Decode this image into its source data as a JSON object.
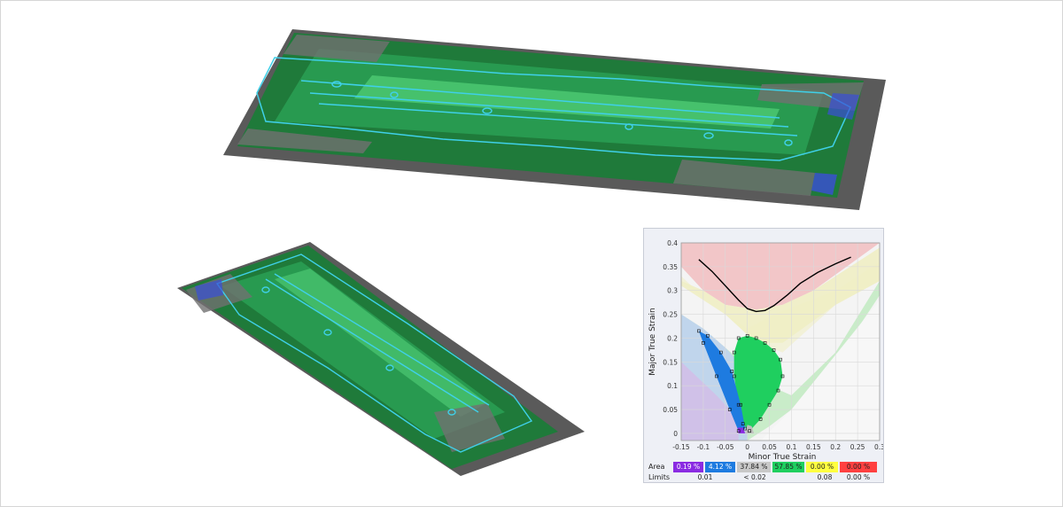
{
  "chart_data": {
    "type": "scatter",
    "title": "",
    "xlabel": "Minor True Strain",
    "ylabel": "Major True Strain",
    "xlim": [
      -0.15,
      0.3
    ],
    "ylim": [
      -0.015,
      0.4
    ],
    "xticks": [
      "-0.15",
      "-0.1",
      "-0.05",
      "0",
      "0.05",
      "0.1",
      "0.15",
      "0.2",
      "0.25",
      "0.3"
    ],
    "xtick_values": [
      -0.15,
      -0.1,
      -0.05,
      0,
      0.05,
      0.1,
      0.15,
      0.2,
      0.25,
      0.3
    ],
    "yticks": [
      "0",
      "0.05",
      "0.1",
      "0.15",
      "0.2",
      "0.25",
      "0.3",
      "0.35",
      "0.4"
    ],
    "ytick_values": [
      0,
      0.05,
      0.1,
      0.15,
      0.2,
      0.25,
      0.3,
      0.35,
      0.4
    ],
    "grid": true,
    "forming_limit_curve": {
      "x": [
        -0.11,
        -0.08,
        -0.05,
        -0.02,
        0.0,
        0.02,
        0.04,
        0.06,
        0.09,
        0.12,
        0.16,
        0.2,
        0.235
      ],
      "y": [
        0.365,
        0.34,
        0.31,
        0.28,
        0.262,
        0.256,
        0.258,
        0.268,
        0.29,
        0.315,
        0.338,
        0.356,
        0.37
      ]
    },
    "zone_colors": {
      "red": "#f2c6c8",
      "yellow": "#f0eec4",
      "green": "#c9ecc9",
      "blue": "#bfd3f0",
      "purple": "#d2bfe8",
      "grey": "#f4f4f4",
      "point_green": "#1fcf5f",
      "point_blue": "#1e7be0",
      "point_purple": "#8a2be2",
      "point_grey": "#bdbdbd"
    },
    "point_cloud": {
      "green_region": [
        [
          -0.02,
          0.2
        ],
        [
          0.0,
          0.205
        ],
        [
          0.02,
          0.2
        ],
        [
          0.04,
          0.19
        ],
        [
          0.06,
          0.175
        ],
        [
          0.075,
          0.155
        ],
        [
          0.08,
          0.12
        ],
        [
          0.07,
          0.09
        ],
        [
          0.05,
          0.06
        ],
        [
          0.03,
          0.03
        ],
        [
          0.005,
          0.005
        ],
        [
          -0.01,
          0.02
        ],
        [
          -0.02,
          0.06
        ],
        [
          -0.03,
          0.12
        ],
        [
          -0.03,
          0.17
        ]
      ],
      "blue_region": [
        [
          -0.11,
          0.215
        ],
        [
          -0.09,
          0.205
        ],
        [
          -0.06,
          0.17
        ],
        [
          -0.035,
          0.13
        ],
        [
          -0.015,
          0.06
        ],
        [
          -0.005,
          0.01
        ],
        [
          -0.02,
          0.005
        ],
        [
          -0.04,
          0.05
        ],
        [
          -0.07,
          0.12
        ],
        [
          -0.1,
          0.19
        ]
      ],
      "purple_region": [
        [
          -0.02,
          0.0
        ],
        [
          -0.005,
          0.0
        ],
        [
          -0.01,
          0.012
        ],
        [
          -0.022,
          0.012
        ]
      ],
      "grey_region": [
        [
          -0.005,
          0.0
        ],
        [
          0.015,
          0.0
        ],
        [
          0.01,
          0.015
        ],
        [
          0.0,
          0.018
        ]
      ]
    },
    "legend": {
      "area_label": "Area",
      "limits_label": "Limits",
      "areas": [
        {
          "text": "0.19 %",
          "color": "#8a2be2",
          "text_color": "#ffffff"
        },
        {
          "text": "4.12 %",
          "color": "#1e7be0",
          "text_color": "#ffffff"
        },
        {
          "text": "37.84 %",
          "color": "#c8c8c8",
          "text_color": "#222222"
        },
        {
          "text": "57.85 %",
          "color": "#1fcf5f",
          "text_color": "#222222"
        },
        {
          "text": "0.00 %",
          "color": "#ffff40",
          "text_color": "#222222"
        },
        {
          "text": "0.00 %",
          "color": "#ff4040",
          "text_color": "#222222"
        }
      ],
      "limits": [
        "0.01",
        "< 0.02",
        "0.08",
        "0.00 %"
      ]
    }
  }
}
